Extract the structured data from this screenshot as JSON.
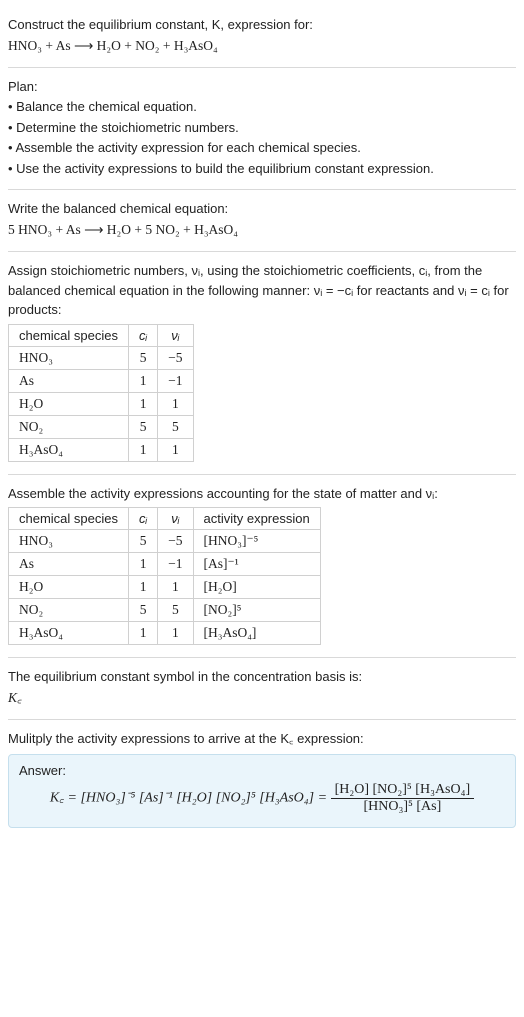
{
  "intro": {
    "line1": "Construct the equilibrium constant, K, expression for:",
    "line2": "HNO₃ + As ⟶ H₂O + NO₂ + H₃AsO₄"
  },
  "plan": {
    "header": "Plan:",
    "b1": "• Balance the chemical equation.",
    "b2": "• Determine the stoichiometric numbers.",
    "b3": "• Assemble the activity expression for each chemical species.",
    "b4": "• Use the activity expressions to build the equilibrium constant expression."
  },
  "balanced": {
    "line1": "Write the balanced chemical equation:",
    "line2": "5 HNO₃ + As ⟶ H₂O + 5 NO₂ + H₃AsO₄"
  },
  "assign": {
    "line1": "Assign stoichiometric numbers, νᵢ, using the stoichiometric coefficients, cᵢ, from the balanced chemical equation in the following manner: νᵢ = −cᵢ for reactants and νᵢ = cᵢ for products:"
  },
  "table1": {
    "h1": "chemical species",
    "h2": "cᵢ",
    "h3": "νᵢ",
    "rows": [
      {
        "s": "HNO₃",
        "c": "5",
        "v": "−5"
      },
      {
        "s": "As",
        "c": "1",
        "v": "−1"
      },
      {
        "s": "H₂O",
        "c": "1",
        "v": "1"
      },
      {
        "s": "NO₂",
        "c": "5",
        "v": "5"
      },
      {
        "s": "H₃AsO₄",
        "c": "1",
        "v": "1"
      }
    ]
  },
  "assemble": {
    "line1": "Assemble the activity expressions accounting for the state of matter and νᵢ:"
  },
  "table2": {
    "h1": "chemical species",
    "h2": "cᵢ",
    "h3": "νᵢ",
    "h4": "activity expression",
    "rows": [
      {
        "s": "HNO₃",
        "c": "5",
        "v": "−5",
        "a": "[HNO₃]⁻⁵"
      },
      {
        "s": "As",
        "c": "1",
        "v": "−1",
        "a": "[As]⁻¹"
      },
      {
        "s": "H₂O",
        "c": "1",
        "v": "1",
        "a": "[H₂O]"
      },
      {
        "s": "NO₂",
        "c": "5",
        "v": "5",
        "a": "[NO₂]⁵"
      },
      {
        "s": "H₃AsO₄",
        "c": "1",
        "v": "1",
        "a": "[H₃AsO₄]"
      }
    ]
  },
  "symbol": {
    "line1": "The equilibrium constant symbol in the concentration basis is:",
    "line2": "K꜀"
  },
  "multiply": {
    "line1": "Mulitply the activity expressions to arrive at the K꜀ expression:"
  },
  "answer": {
    "label": "Answer:",
    "lhs": "K꜀ = [HNO₃]⁻⁵ [As]⁻¹ [H₂O] [NO₂]⁵ [H₃AsO₄] = ",
    "num": "[H₂O] [NO₂]⁵ [H₃AsO₄]",
    "den": "[HNO₃]⁵ [As]"
  },
  "chart_data": {
    "type": "table",
    "tables": [
      {
        "title": "stoichiometric numbers",
        "columns": [
          "chemical species",
          "c_i",
          "ν_i"
        ],
        "rows": [
          [
            "HNO3",
            5,
            -5
          ],
          [
            "As",
            1,
            -1
          ],
          [
            "H2O",
            1,
            1
          ],
          [
            "NO2",
            5,
            5
          ],
          [
            "H3AsO4",
            1,
            1
          ]
        ]
      },
      {
        "title": "activity expressions",
        "columns": [
          "chemical species",
          "c_i",
          "ν_i",
          "activity expression"
        ],
        "rows": [
          [
            "HNO3",
            5,
            -5,
            "[HNO3]^-5"
          ],
          [
            "As",
            1,
            -1,
            "[As]^-1"
          ],
          [
            "H2O",
            1,
            1,
            "[H2O]"
          ],
          [
            "NO2",
            5,
            5,
            "[NO2]^5"
          ],
          [
            "H3AsO4",
            1,
            1,
            "[H3AsO4]"
          ]
        ]
      }
    ],
    "equilibrium_expression": "Kc = [H2O][NO2]^5[H3AsO4] / ([HNO3]^5 [As])"
  }
}
